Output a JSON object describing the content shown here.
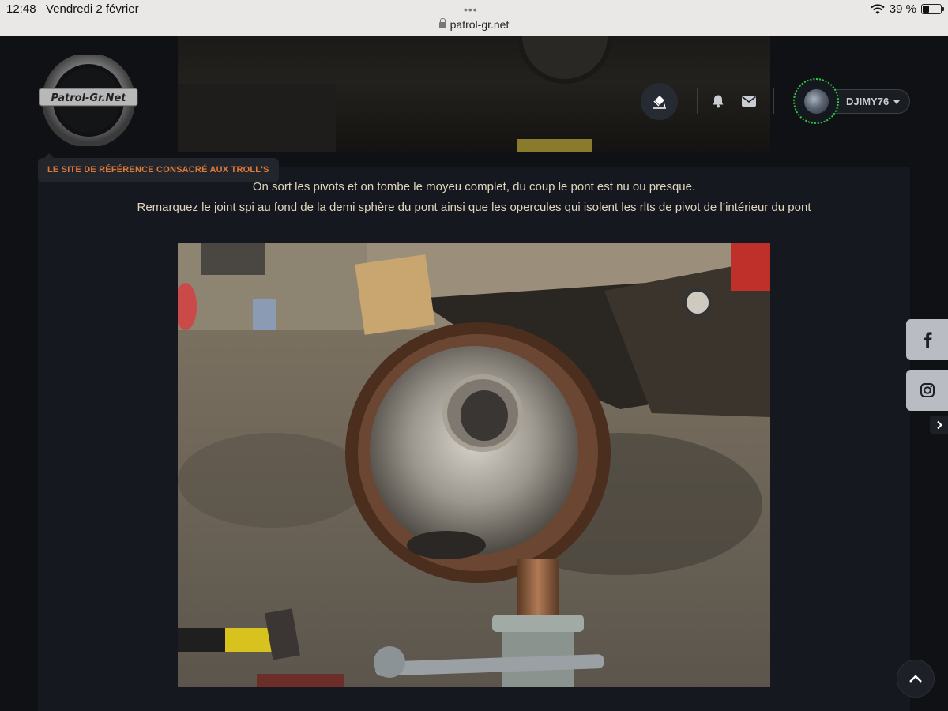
{
  "status_bar": {
    "time": "12:48",
    "date": "Vendredi 2 février",
    "url": "patrol-gr.net",
    "battery": "39 %",
    "battery_level": 0.39
  },
  "header": {
    "logo_text": "Patrol-Gr.Net",
    "tagline": "LE SITE DE RÉFÉRENCE CONSACRÉ AUX TROLL'S",
    "icons": {
      "theme": "paint-bucket-icon",
      "notifications": "bell-icon",
      "messages": "envelope-icon"
    },
    "user": {
      "name": "DJIMY76"
    }
  },
  "post": {
    "lines": [
      "On sort les pivots et on tombe le moyeu complet, du coup le pont est nu ou presque.",
      "Remarquez le joint spi au fond de la demi sphère du pont ainsi que les opercules qui isolent les rlts de pivot de l’intérieur du pont"
    ],
    "image_alt": "Demi sphère de pont avec joint spi"
  },
  "social": {
    "facebook": "facebook-icon",
    "instagram": "instagram-icon"
  },
  "colors": {
    "background": "#0f1115",
    "content": "#15181e",
    "tagline": "#e07a3a",
    "post_text": "#e0d6bd",
    "online_ring": "#2ecc40"
  }
}
